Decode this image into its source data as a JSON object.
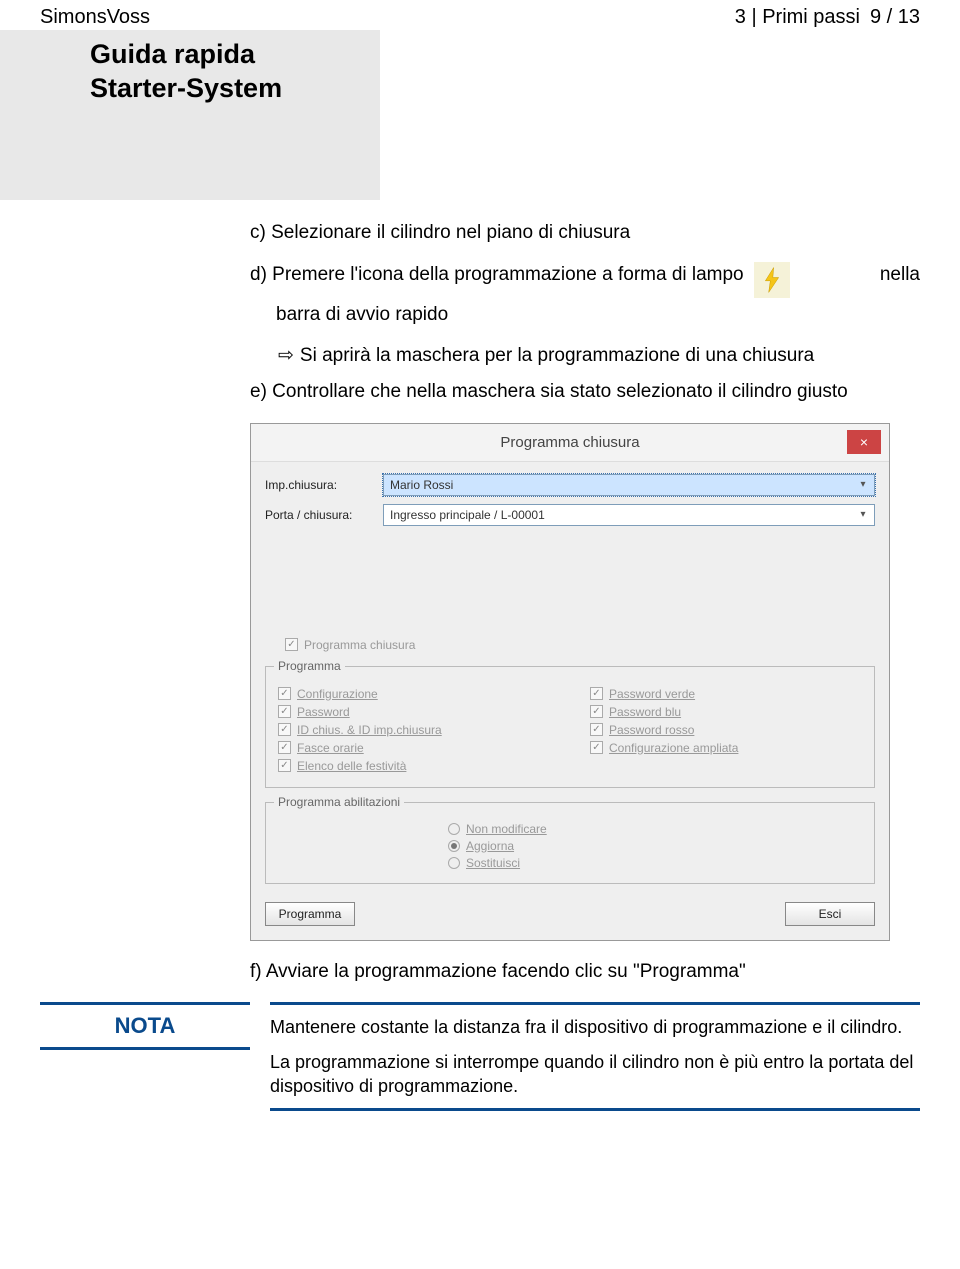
{
  "header": {
    "brand": "SimonsVoss",
    "breadcrumb": "3 | Primi passi",
    "page_num": "9 / 13",
    "guide_title_1": "Guida rapida",
    "guide_title_2": "Starter-System"
  },
  "steps": {
    "c": "c) Selezionare il cilindro nel piano di chiusura",
    "d_before": "d) Premere l'icona della programmazione a forma di lampo",
    "d_after": "nella",
    "d_line2": "barra di avvio rapido",
    "d_sub": "Si aprirà la maschera per la programmazione di una chiusura",
    "e": "e) Controllare che nella maschera sia stato selezionato il cilindro giusto",
    "f": "f) Avviare la programmazione facendo clic su \"Programma\""
  },
  "icon": {
    "lightning": "lightning-icon"
  },
  "dialog": {
    "title": "Programma chiusura",
    "close": "×",
    "labels": {
      "imp": "Imp.chiusura:",
      "porta": "Porta / chiusura:"
    },
    "values": {
      "imp": "Mario Rossi",
      "porta": "Ingresso principale / L-00001"
    },
    "check_programma_chiusura": "Programma chiusura",
    "group_programma": {
      "legend": "Programma",
      "left": [
        "Configurazione",
        "Password",
        "ID chius. & ID imp.chiusura",
        "Fasce orarie",
        "Elenco delle festività"
      ],
      "right": [
        "Password verde",
        "Password blu",
        "Password rosso",
        "Configurazione ampliata"
      ]
    },
    "group_abilitazioni": {
      "legend": "Programma abilitazioni",
      "options": [
        "Non modificare",
        "Aggiorna",
        "Sostituisci"
      ],
      "selected": 1
    },
    "buttons": {
      "programma": "Programma",
      "esci": "Esci"
    }
  },
  "nota": {
    "badge": "NOTA",
    "p1": "Mantenere costante la distanza fra il dispositivo di programmazione e il cilindro.",
    "p2": "La programmazione si interrompe quando il cilindro non è più entro la portata del dispositivo di programmazione."
  }
}
